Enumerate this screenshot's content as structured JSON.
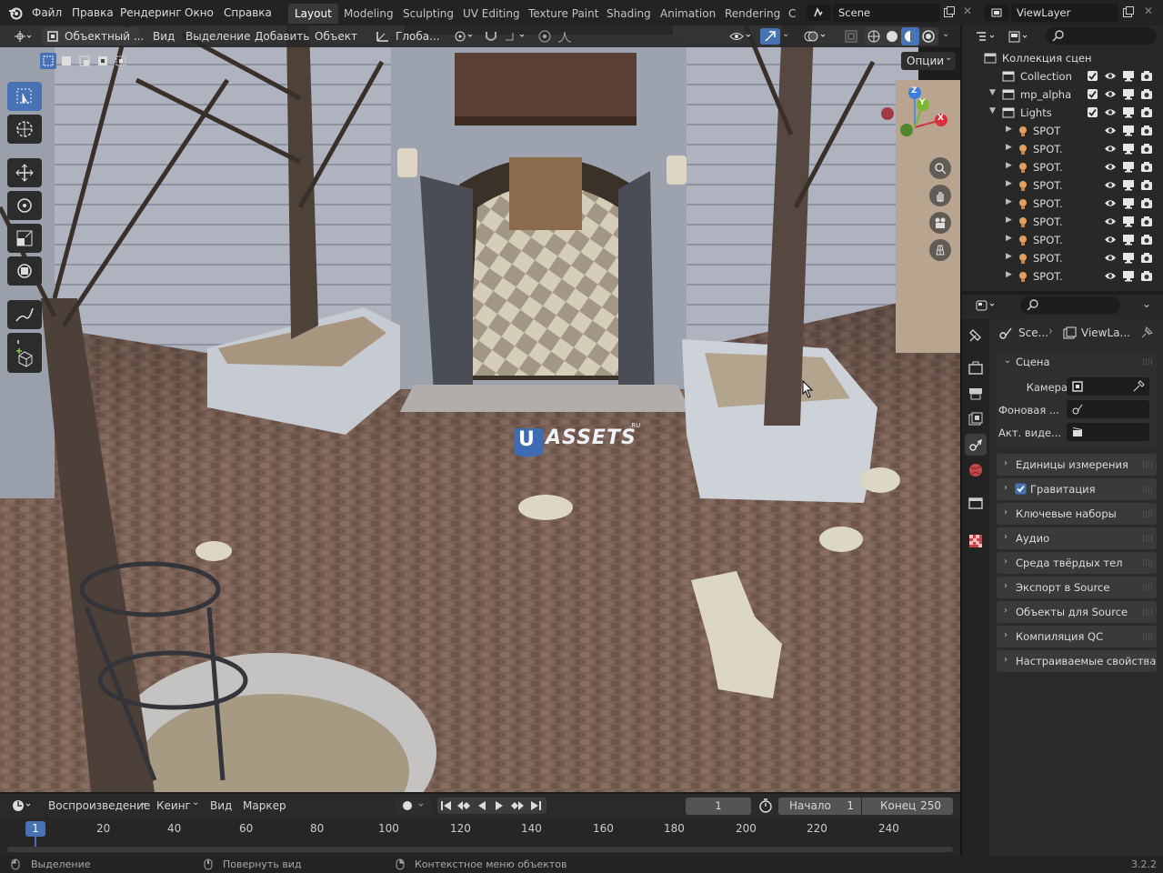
{
  "topbar": {
    "menus": [
      "Файл",
      "Правка",
      "Рендеринг",
      "Окно",
      "Справка"
    ],
    "workspaces": [
      "Layout",
      "Modeling",
      "Sculpting",
      "UV Editing",
      "Texture Paint",
      "Shading",
      "Animation",
      "Rendering",
      "C"
    ],
    "active_workspace": "Layout",
    "scene_name": "Scene",
    "view_layer": "ViewLayer"
  },
  "viewport": {
    "mode": "Объектный ...",
    "menus": [
      "Вид",
      "Выделение",
      "Добавить",
      "Объект"
    ],
    "transform_orientation": "Глоба...",
    "options_label": "Опции",
    "watermark": "ASSETS",
    "watermark_suffix": ".RU",
    "gizmo": {
      "x": "X",
      "y": "Y",
      "z": "Z"
    }
  },
  "timeline": {
    "menus": [
      "Воспроизведение",
      "Кеинг",
      "Вид",
      "Маркер"
    ],
    "current_frame": "1",
    "start_label": "Начало",
    "start_value": "1",
    "end_label": "Конец",
    "end_value": "250",
    "ruler": [
      "1",
      "20",
      "40",
      "60",
      "80",
      "100",
      "120",
      "140",
      "160",
      "180",
      "200",
      "220",
      "240"
    ]
  },
  "statusbar": {
    "left": "Выделение",
    "middle": "Повернуть вид",
    "right": "Контекстное меню объектов",
    "version": "3.2.2"
  },
  "outliner": {
    "root": "Коллекция сцен",
    "rows": [
      {
        "label": "Collection",
        "indent": 0
      },
      {
        "label": "mp_alpha",
        "indent": 0
      },
      {
        "label": "Lights",
        "indent": 1
      },
      {
        "label": "SPOT",
        "indent": 2
      },
      {
        "label": "SPOT.",
        "indent": 2
      },
      {
        "label": "SPOT.",
        "indent": 2
      },
      {
        "label": "SPOT.",
        "indent": 2
      },
      {
        "label": "SPOT.",
        "indent": 2
      },
      {
        "label": "SPOT.",
        "indent": 2
      },
      {
        "label": "SPOT.",
        "indent": 2
      },
      {
        "label": "SPOT.",
        "indent": 2
      },
      {
        "label": "SPOT.",
        "indent": 2
      }
    ]
  },
  "properties": {
    "breadcrumb_scene": "Sce...",
    "breadcrumb_layer": "ViewLa...",
    "section_title": "Сцена",
    "fields": [
      {
        "label": "Камера"
      },
      {
        "label": "Фоновая ..."
      },
      {
        "label": "Акт. виде..."
      }
    ],
    "panels": [
      {
        "label": "Единицы измерения",
        "checkbox": false
      },
      {
        "label": "Гравитация",
        "checkbox": true
      },
      {
        "label": "Ключевые наборы",
        "checkbox": false
      },
      {
        "label": "Аудио",
        "checkbox": false
      },
      {
        "label": "Среда твёрдых тел",
        "checkbox": false
      },
      {
        "label": "Экспорт в Source",
        "checkbox": false
      },
      {
        "label": "Объекты для Source",
        "checkbox": false
      },
      {
        "label": "Компиляция QC",
        "checkbox": false
      },
      {
        "label": "Настраиваемые свойства",
        "checkbox": false
      }
    ]
  },
  "colors": {
    "accent": "#4772b3",
    "bg": "#1d1d1d",
    "panel": "#3a3a3a"
  }
}
